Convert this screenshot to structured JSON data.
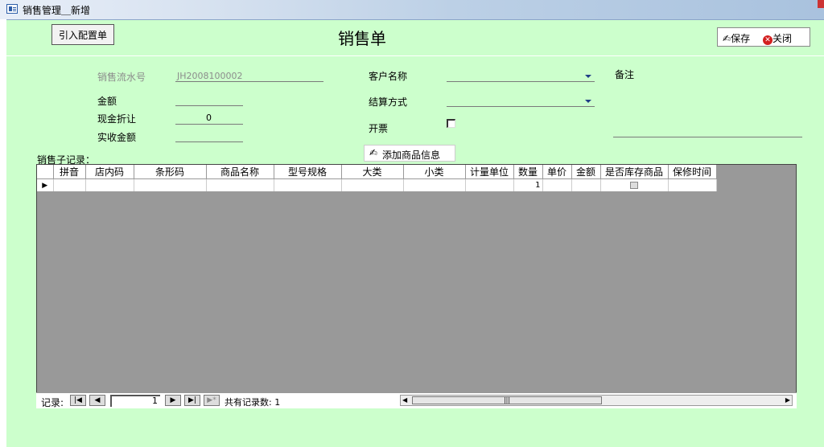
{
  "window": {
    "title": "销售管理＿新增"
  },
  "toolbar": {
    "import_label": "引入配置单",
    "form_title": "销售单",
    "save_label": "保存",
    "close_label": "关闭"
  },
  "form": {
    "serial_label": "销售流水号",
    "serial_value": "JH2008100002",
    "amount_label": "金额",
    "cash_discount_label": "现金折让",
    "cash_discount_value": "0",
    "received_label": "实收金额",
    "customer_label": "客户名称",
    "settlement_label": "结算方式",
    "invoice_label": "开票",
    "remark_label": "备注",
    "add_product_label": "添加商品信息",
    "subrecords_label": "销售子记录："
  },
  "grid": {
    "columns": [
      "拼音",
      "店内码",
      "条形码",
      "商品名称",
      "型号规格",
      "大类",
      "小类",
      "计量单位",
      "数量",
      "单价",
      "金额",
      "是否库存商品",
      "保修时间"
    ],
    "rows": [
      [
        "",
        "",
        "",
        "",
        "",
        "",
        "",
        "",
        "1",
        "",
        "",
        "",
        ""
      ]
    ]
  },
  "nav": {
    "record_label": "记录:",
    "current": "1",
    "total_label": "共有记录数: 1",
    "first_icon": "first-record-icon",
    "prev_icon": "prev-record-icon",
    "next_icon": "next-record-icon",
    "last_icon": "last-record-icon",
    "new_icon": "new-record-icon"
  }
}
